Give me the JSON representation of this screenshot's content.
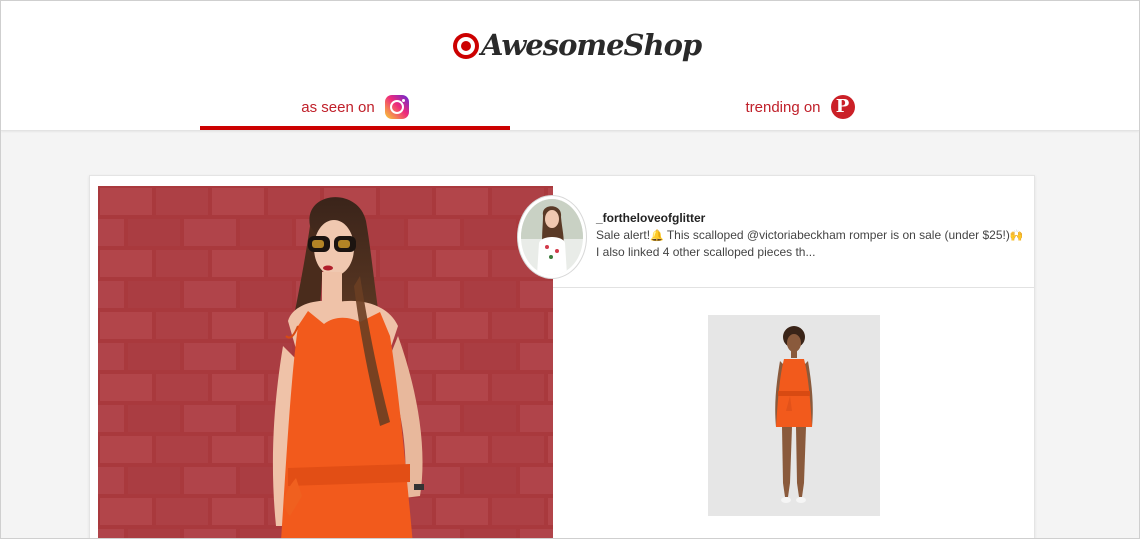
{
  "header": {
    "logo_text": "AwesomeShop",
    "logo_icon": "target-bullseye-icon",
    "tabs": [
      {
        "label": "as seen on",
        "icon": "instagram-icon",
        "active": true
      },
      {
        "label": "trending on",
        "icon": "pinterest-icon",
        "active": false
      }
    ]
  },
  "colors": {
    "brand_red": "#cc0000",
    "tab_text": "#c0202a",
    "page_bg": "#f4f4f4",
    "card_bg": "#ffffff",
    "wall_red": "#a83a3e",
    "dress_orange": "#f25a1c"
  },
  "post": {
    "username": "_fortheloveofglitter",
    "caption_part1": "Sale alert!",
    "caption_emoji1": "🔔",
    "caption_part2": " This scalloped @victoriabeckham romper is on sale (under $25!)",
    "caption_emoji2": "🙌",
    "caption_part3": " I also linked 4 other scalloped pieces th..."
  },
  "product": {
    "image_label": "orange-romper-product-image"
  }
}
